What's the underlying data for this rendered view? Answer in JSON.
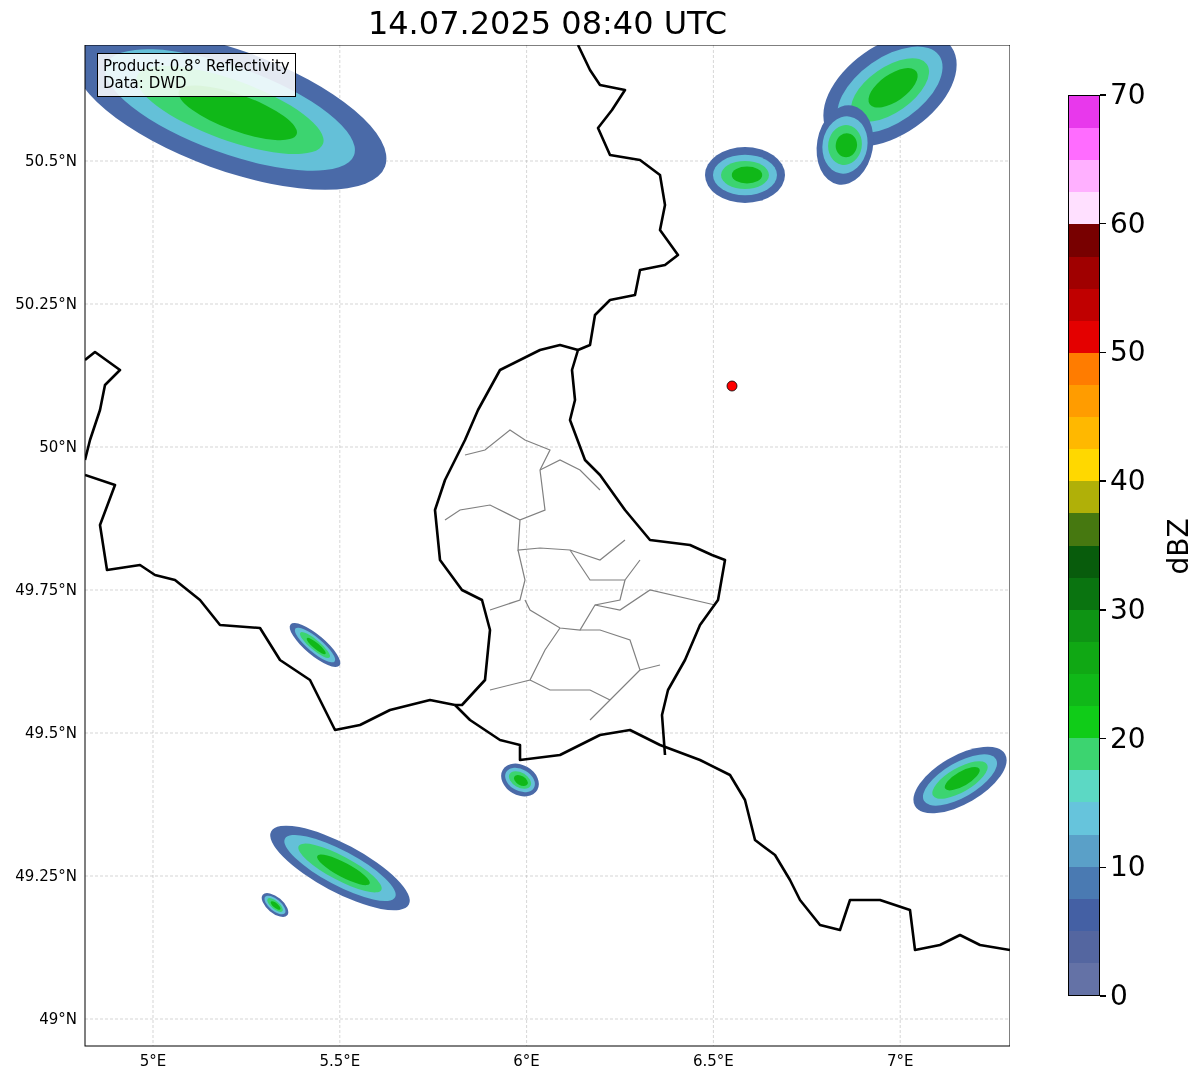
{
  "title": "14.07.2025 08:40 UTC",
  "annotation": {
    "lines": [
      "Product: 0.8° Reflectivity",
      "Data: DWD"
    ]
  },
  "map": {
    "lat_ticks": [
      "50.5°N",
      "50.25°N",
      "50°N",
      "49.75°N",
      "49.5°N",
      "49.25°N",
      "49°N"
    ],
    "lon_ticks": [
      "5°E",
      "5.5°E",
      "6°E",
      "6.5°E",
      "7°E"
    ]
  },
  "colorbar": {
    "label": "dBZ",
    "ticks": [
      "70",
      "60",
      "50",
      "40",
      "30",
      "20",
      "10",
      "0"
    ],
    "segments": [
      {
        "color": "#e838ec"
      },
      {
        "color": "#ff6cff"
      },
      {
        "color": "#ffb0ff"
      },
      {
        "color": "#ffe0ff"
      },
      {
        "color": "#780000"
      },
      {
        "color": "#a00000"
      },
      {
        "color": "#c00000"
      },
      {
        "color": "#e40000"
      },
      {
        "color": "#ff7c00"
      },
      {
        "color": "#ff9c00"
      },
      {
        "color": "#ffb800"
      },
      {
        "color": "#ffd800"
      },
      {
        "color": "#b0b008"
      },
      {
        "color": "#467810"
      },
      {
        "color": "#085c0c"
      },
      {
        "color": "#0a7410"
      },
      {
        "color": "#0e9414"
      },
      {
        "color": "#10a814"
      },
      {
        "color": "#10b818"
      },
      {
        "color": "#10cc18"
      },
      {
        "color": "#3cd470"
      },
      {
        "color": "#5cd8c4"
      },
      {
        "color": "#66c4dc"
      },
      {
        "color": "#5aa0c8"
      },
      {
        "color": "#4a7ab2"
      },
      {
        "color": "#4460a4"
      },
      {
        "color": "#5466a0"
      },
      {
        "color": "#6472a6"
      }
    ]
  }
}
